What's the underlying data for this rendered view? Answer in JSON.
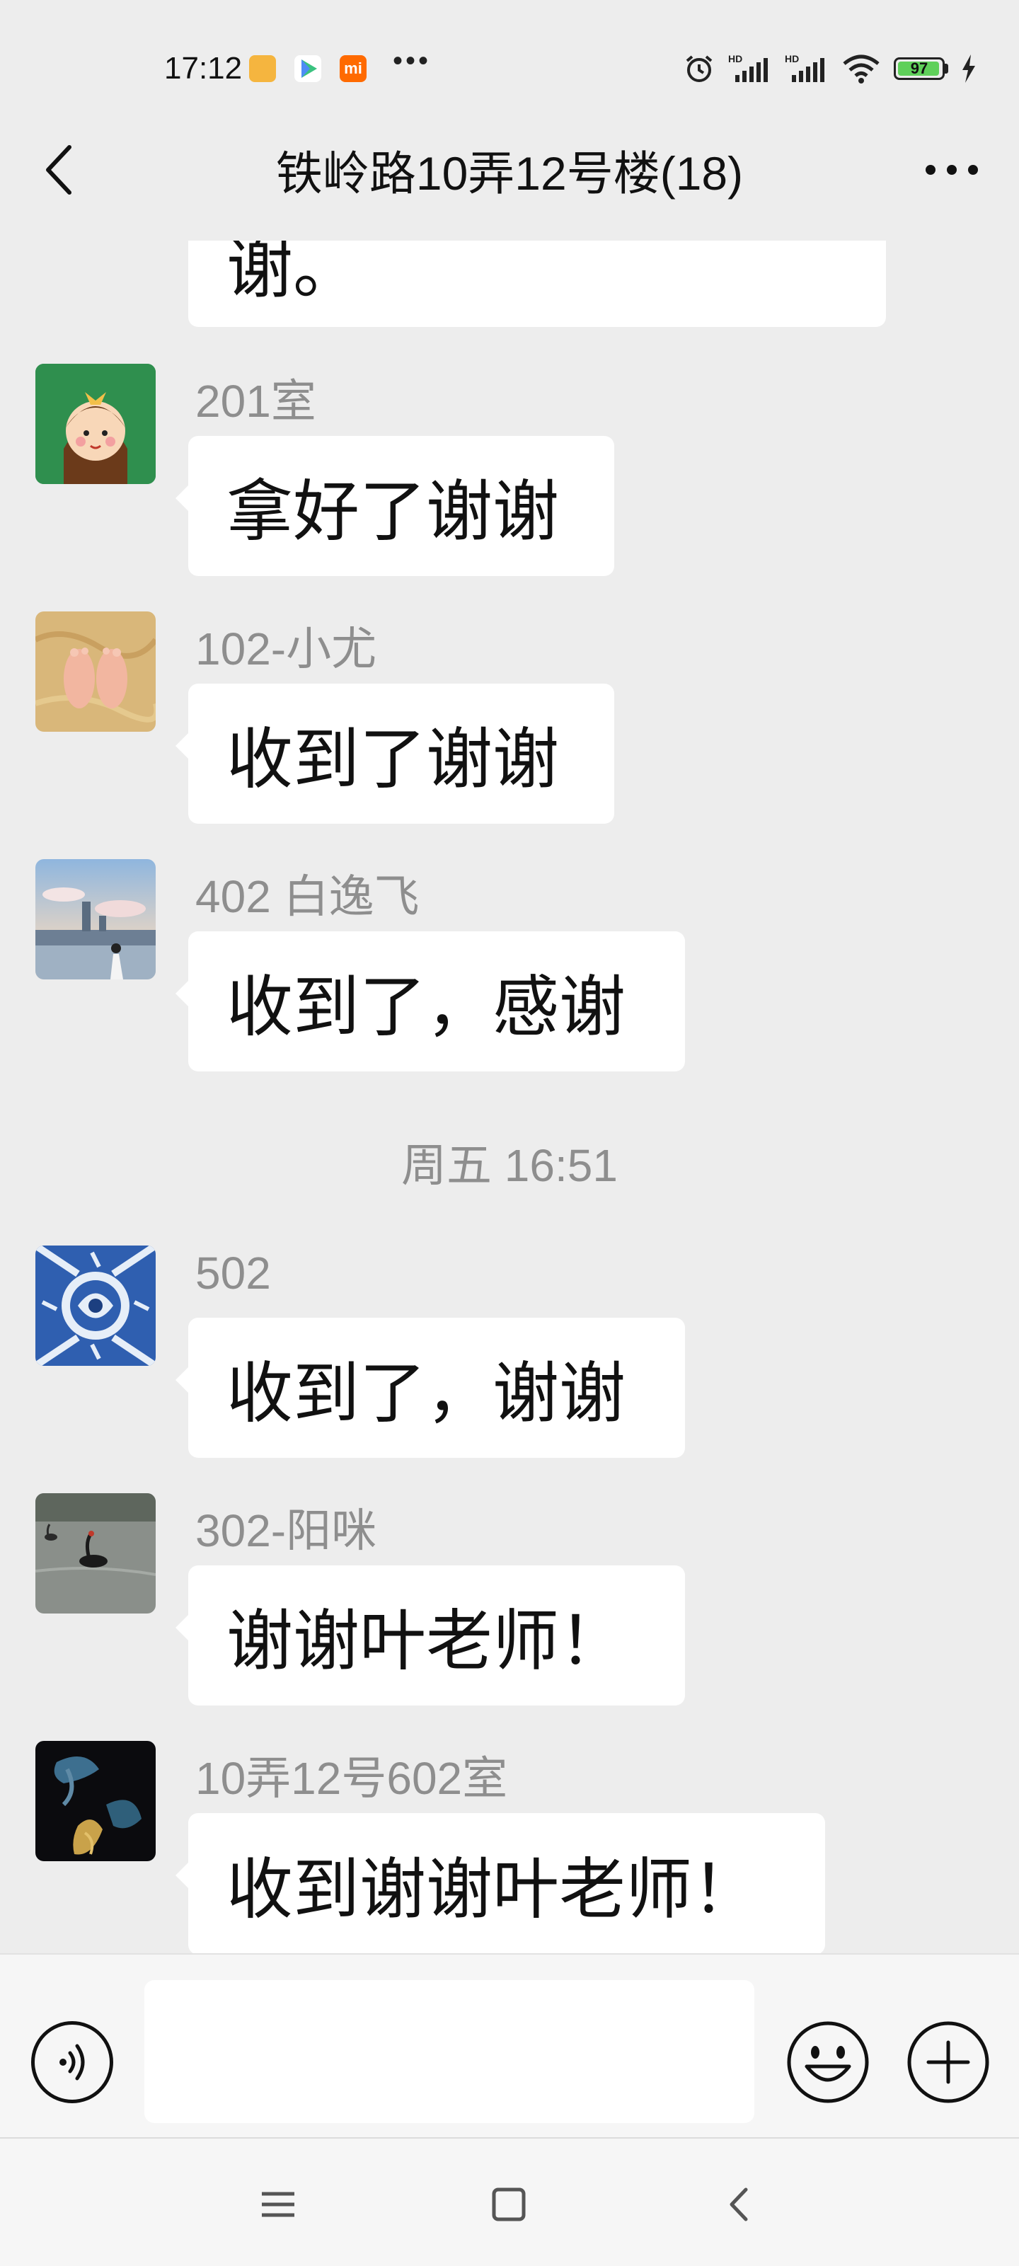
{
  "status_bar": {
    "time": "17:12",
    "dots": "•••",
    "battery_level": "97",
    "icons": [
      "alarm-icon",
      "hd-signal-icon",
      "hd-signal-icon",
      "wifi-icon",
      "battery-icon",
      "charging-icon"
    ]
  },
  "header": {
    "title": "铁岭路10弄12号楼(18)",
    "back_icon": "back-arrow-icon",
    "more_icon": "more-dots-icon"
  },
  "messages": [
    {
      "sender": "",
      "text": "谢。"
    },
    {
      "sender": "201室",
      "text": "拿好了谢谢",
      "avatar": "cartoon-girl-avatar"
    },
    {
      "sender": "102-小尤",
      "text": "收到了谢谢",
      "avatar": "baby-feet-avatar"
    },
    {
      "sender": "402 白逸飞",
      "text": "收到了，感谢",
      "avatar": "city-skyline-avatar"
    },
    {
      "sender": "502",
      "text": "收到了，谢谢",
      "avatar": "blue-tile-avatar"
    },
    {
      "sender": "302-阳咪",
      "text": "谢谢叶老师！",
      "avatar": "swan-lake-avatar"
    },
    {
      "sender": "10弄12号602室",
      "text": "收到谢谢叶老师！",
      "avatar": "betta-fish-avatar"
    }
  ],
  "timestamp": "周五 16:51",
  "input_bar": {
    "value": "",
    "voice_icon": "voice-icon",
    "emoji_icon": "emoji-icon",
    "plus_icon": "plus-icon"
  },
  "nav_bar": {
    "icons": [
      "menu-icon",
      "home-square-icon",
      "back-chevron-icon"
    ]
  },
  "colors": {
    "background": "#ededed",
    "bubble": "#ffffff",
    "sender_text": "#8e8e8e",
    "battery_green": "#5fd05a"
  }
}
